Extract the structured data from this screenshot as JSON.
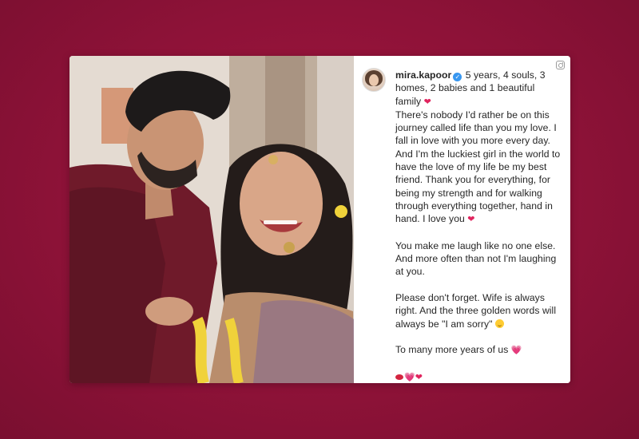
{
  "post": {
    "username": "mira.kapoor",
    "verified_icon": "verified-badge-icon",
    "caption_intro": "5 years, 4 souls, 3 homes, 2 babies and 1 beautiful family",
    "paragraph_1": "There's nobody I'd rather be on this journey called life than you my love. I fall in love with you more every day. And I'm the luckiest girl in the world to have the love of my life be my best friend. Thank you for everything, for being my strength and for walking through everything together, hand in hand. I love you",
    "paragraph_2": "You make me laugh like no one else. And more often than not I'm laughing at you.",
    "paragraph_3": "Please don't forget. Wife is always right. And the three golden words will always be \"I am sorry\"",
    "paragraph_4": "To many more years of us",
    "emoji_heart": "❤",
    "emoji_pink_heart": "💗",
    "icons": [
      "instagram-icon",
      "red-heart-icon",
      "smiling-face-icon",
      "pink-heart-icon",
      "kiss-icon"
    ]
  },
  "colors": {
    "background": "#8e1238",
    "text": "#262626",
    "verified": "#3897f0",
    "heart": "#e0245e"
  }
}
